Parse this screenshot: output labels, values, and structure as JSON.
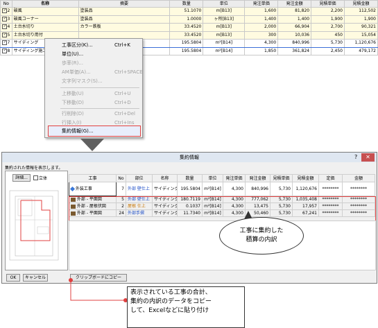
{
  "grid": {
    "headers": [
      "No",
      "名称",
      "摘要",
      "数量",
      "単位",
      "発注単価",
      "発注金額",
      "見積単価",
      "見積金額"
    ],
    "rows": [
      {
        "no": "2",
        "name": "破風",
        "desc": "塗装品",
        "qty": "51.1070",
        "unit": "m[B13]",
        "up": "1,600",
        "amt": "81,820",
        "eup": "2,200",
        "eamt": "112,502"
      },
      {
        "no": "3",
        "name": "破風コーナー",
        "desc": "塗装品",
        "qty": "1.0000",
        "unit": "ヶ所[B13]",
        "up": "1,400",
        "amt": "1,400",
        "eup": "1,900",
        "eamt": "1,900"
      },
      {
        "no": "4",
        "name": "土台水切り",
        "desc": "カラー鉄板",
        "qty": "33.4520",
        "unit": "m[B13]",
        "up": "2,000",
        "amt": "66,904",
        "eup": "2,700",
        "eamt": "90,321"
      },
      {
        "no": "5",
        "name": "土台水切り用付",
        "desc": "",
        "qty": "33.4520",
        "unit": "m[B13]",
        "up": "300",
        "amt": "10,036",
        "eup": "450",
        "eamt": "15,054"
      },
      {
        "no": "7",
        "name": "サイディング",
        "desc": "",
        "qty": "195.5804",
        "unit": "m²[B14]",
        "up": "4,300",
        "amt": "840,996",
        "eup": "5,730",
        "eamt": "1,120,676"
      },
      {
        "no": "8",
        "name": "サイディング施工手間",
        "desc": "",
        "qty": "195.5804",
        "unit": "m²[B14]",
        "up": "1,850",
        "amt": "361,824",
        "eup": "2,450",
        "eamt": "479,172"
      }
    ]
  },
  "menu": [
    {
      "label": "工事区分(K)...",
      "shortcut": "Ctrl+K",
      "disabled": false
    },
    {
      "label": "単位(U)...",
      "shortcut": "",
      "disabled": false
    },
    {
      "label": "歩率(R)...",
      "shortcut": "",
      "disabled": true
    },
    {
      "label": "AM単価(A)...",
      "shortcut": "Ctrl+SPACE",
      "disabled": true
    },
    {
      "label": "文字列マスク(S)...",
      "shortcut": "",
      "disabled": true
    },
    {
      "label": "上移動(U)",
      "shortcut": "Ctrl+U",
      "disabled": true
    },
    {
      "label": "下移動(D)",
      "shortcut": "Ctrl+D",
      "disabled": true
    },
    {
      "label": "行削除(D)",
      "shortcut": "Ctrl+Del",
      "disabled": true
    },
    {
      "label": "行挿入(I)",
      "shortcut": "Ctrl+Ins",
      "disabled": true
    },
    {
      "label": "集約情報(G)...",
      "shortcut": "",
      "disabled": false
    }
  ],
  "dialog": {
    "title": "集約情報",
    "help": "?",
    "close": "✕",
    "info": "集約された情報を表示します。",
    "detail_button": "詳細...",
    "solid_label": "立体",
    "ok": "OK",
    "cancel": "キャンセル",
    "clipboard": "クリップボードにコピー",
    "headers": [
      "工事",
      "No",
      "部位",
      "名称",
      "数量",
      "単位",
      "発注単価",
      "発注金額",
      "見積単価",
      "見積金額",
      "定価",
      "金額"
    ],
    "summary": {
      "koji": "外装工事",
      "no": "7",
      "part": "外部 壁仕上",
      "name": "サイディング",
      "qty": "195.5804",
      "unit": "m²[B14]",
      "up": "4,300",
      "amt": "840,996",
      "eup": "5,730",
      "eamt": "1,120,676",
      "price": "********",
      "total": "********"
    },
    "rows": [
      {
        "koji": "外部 - 平面図",
        "no": "5",
        "part": "外部 壁仕上",
        "name": "サイディング",
        "qty": "180.7119",
        "unit": "m²[B14]",
        "up": "4,300",
        "amt": "777,062",
        "eup": "5,730",
        "eamt": "1,035,408",
        "price": "********",
        "total": "********"
      },
      {
        "koji": "外部 - 屋根伏図",
        "no": "2",
        "part": "屋根 仕上",
        "name": "サイディング",
        "qty": "0.1037",
        "unit": "m²[B14]",
        "up": "4,300",
        "amt": "13,475",
        "eup": "5,730",
        "eamt": "17,957",
        "price": "********",
        "total": "********"
      },
      {
        "koji": "外部 - 平面図",
        "no": "24",
        "part": "外部手摺",
        "name": "サイディング",
        "qty": "11.7340",
        "unit": "m²[B14]",
        "up": "4,300",
        "amt": "50,460",
        "eup": "5,730",
        "eamt": "67,241",
        "price": "********",
        "total": "********"
      }
    ]
  },
  "callout": {
    "line1": "工事に集約した",
    "line2": "積算の内訳"
  },
  "note": {
    "line1": "表示されている工事の合計、",
    "line2": "集約の内訳のデータをコピー",
    "line3": "して、Excelなどに貼り付け"
  }
}
